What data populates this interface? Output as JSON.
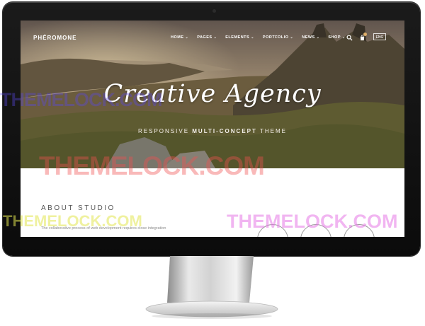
{
  "site": {
    "logo": "PHÉROMONE",
    "nav": [
      {
        "label": "HOME"
      },
      {
        "label": "PAGES"
      },
      {
        "label": "ELEMENTS"
      },
      {
        "label": "PORTFOLIO"
      },
      {
        "label": "NEWS"
      },
      {
        "label": "SHOP"
      }
    ],
    "chevron": "⌄",
    "language": "ENG",
    "icons": [
      "search-icon",
      "cart-icon"
    ]
  },
  "hero": {
    "title": "Creative Agency",
    "subtitle_pre": "RESPONSIVE",
    "subtitle_strong": "MULTI-CONCEPT",
    "subtitle_post": "THEME"
  },
  "about": {
    "title": "ABOUT STUDIO",
    "text": "The collaborative process of web development requires close integration"
  },
  "watermarks": [
    "THEMELOCK.COM",
    "THEMELOCK.COM",
    "THEMELOCK.COM",
    "THEMELOCK.COM"
  ],
  "colors": {
    "bezel": "#111111",
    "accent": "#e0b06a",
    "wm_blue": "#5a46e6",
    "wm_red": "#f05050",
    "wm_yellow": "#e1e650",
    "wm_pink": "#e678e6"
  }
}
